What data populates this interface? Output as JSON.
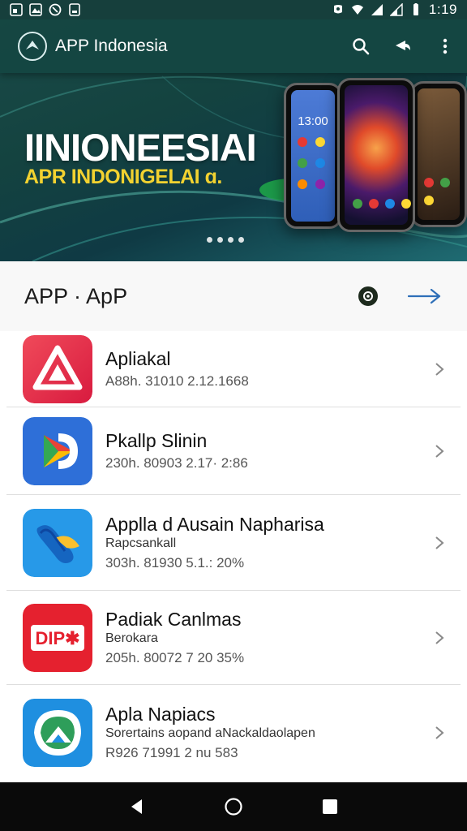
{
  "status_bar": {
    "time": "1:19",
    "left_icons": [
      "notification-icon",
      "photo-icon",
      "sync-icon",
      "sd-card-icon"
    ],
    "right_icons": [
      "vibrate-icon",
      "wifi-icon",
      "signal-icon",
      "signal-icon",
      "battery-icon"
    ]
  },
  "header": {
    "title": "APP Indonesia",
    "actions": [
      "search-icon",
      "share-icon",
      "more-vertical-icon"
    ]
  },
  "banner": {
    "headline": "IINIONEESIAI",
    "subheadline": "APR INDONIGELAI ɑ.",
    "phone_time": "13:00",
    "carousel_dots": 4
  },
  "section": {
    "title": "APP · ApP"
  },
  "apps": [
    {
      "name": "Apliakal",
      "description": "",
      "meta": "A88h. 31010 2.12.1668",
      "icon": "red-triangle-app-icon",
      "color": "#e8324a"
    },
    {
      "name": "Pkallp Slinin",
      "description": "",
      "meta": "230h. 80903 2.17· 2:86",
      "icon": "blue-play-app-icon",
      "color": "#2e6fd8"
    },
    {
      "name": "Applla d Ausain Napharisa",
      "description": "Rapcsankall",
      "meta": "303h. 81930 5.1.: 20%",
      "icon": "blue-bird-app-icon",
      "color": "#2799e8"
    },
    {
      "name": "Padiak Canlmas",
      "description": "Berokara",
      "meta": "205h. 80072 7 20 35%",
      "icon": "red-dip-app-icon",
      "color": "#e5212f"
    },
    {
      "name": "Apla Napiacs",
      "description": "Sorertains aopand aNackaldaolapen",
      "meta": "R926 71991 2 nu 583",
      "icon": "green-map-app-icon",
      "color": "#1f8fe0"
    }
  ],
  "nav": {
    "buttons": [
      "back-icon",
      "home-icon",
      "recents-icon"
    ]
  }
}
